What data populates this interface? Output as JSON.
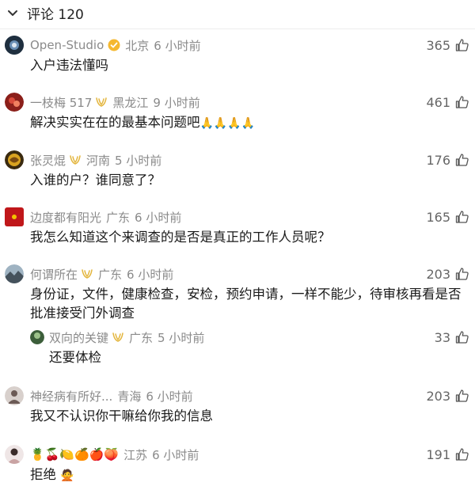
{
  "header": {
    "title": "评论 120"
  },
  "comments": [
    {
      "name": "Open-Studio",
      "location": "北京",
      "time": "6 小时前",
      "likes": "365",
      "text": "入户违法懂吗"
    },
    {
      "name": "一枝梅 517",
      "location": "黑龙江",
      "time": "9 小时前",
      "likes": "461",
      "text": "解决实实在在的最基本问题吧",
      "emoji": "🙏🙏🙏🙏"
    },
    {
      "name": "张灵焜",
      "location": "河南",
      "time": "5 小时前",
      "likes": "176",
      "text": "入谁的户？谁同意了？"
    },
    {
      "name": "边度都有阳光",
      "location": "广东",
      "time": "6 小时前",
      "likes": "165",
      "text": "我怎么知道这个来调查的是否是真正的工作人员呢？"
    },
    {
      "name": "何谓所在",
      "location": "广东",
      "time": "6 小时前",
      "likes": "203",
      "text": "身份证，文件，健康检查，安检，预约申请，一样不能少，待审核再看是否批准接受门外调查"
    },
    {
      "name": "双向的关键",
      "location": "广东",
      "time": "5 小时前",
      "likes": "33",
      "text": "还要体检"
    },
    {
      "name": "神经病有所好...",
      "location": "青海",
      "time": "6 小时前",
      "likes": "203",
      "text": "我又不认识你干嘛给你我的信息"
    },
    {
      "name": "🍍🍒🍋🍊🍎🍑",
      "location": "江苏",
      "time": "6 小时前",
      "likes": "191",
      "text": "拒绝",
      "emoji": "🙅"
    }
  ],
  "colors": {
    "meta": "#8a8a8a",
    "badge_gold": "#e3b53c",
    "verified": "#f5b830"
  }
}
